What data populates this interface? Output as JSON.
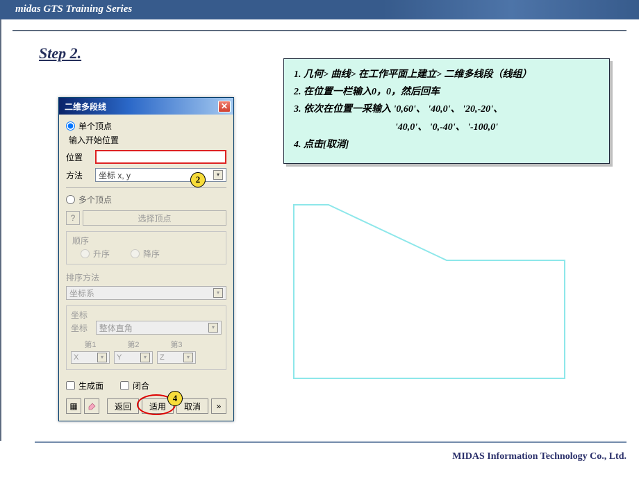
{
  "header": {
    "title": "midas GTS Training Series"
  },
  "step": {
    "label": "Step 2."
  },
  "instructions": {
    "line1": "1. 几何> 曲线> 在工作平面上建立> 二维多线段（线组）",
    "line2": "2. 在位置一栏输入0，0，然后回车",
    "line3": "3. 依次在位置一采输入 '0,60'、 '40,0'、 '20,-20'、",
    "line3b": "'40,0'、 '0,-40'、 '-100,0'",
    "line4": "4. 点击[取消]"
  },
  "dialog": {
    "title": "二维多段线",
    "radio_single": "单个顶点",
    "subtitle": "输入开始位置",
    "loc_label": "位置",
    "method_label": "方法",
    "method_value": "坐标 x, y",
    "radio_multi": "多个顶点",
    "select_vertex": "选择顶点",
    "order_title": "顺序",
    "asc": "升序",
    "desc": "降序",
    "sort_label": "排序方法",
    "sort_value": "坐标系",
    "coord_title": "坐标",
    "coord_label": "坐标",
    "coord_value": "整体直角",
    "col1": "第1",
    "col2": "第2",
    "col3": "第3",
    "c1": "X",
    "c2": "Y",
    "c3": "Z",
    "chk_face": "生成面",
    "chk_close": "闭合",
    "back": "返回",
    "apply": "适用",
    "cancel": "取消",
    "arrow": "»"
  },
  "markers": {
    "m2": "2",
    "m4": "4"
  },
  "footer": {
    "text": "MIDAS Information Technology Co., Ltd."
  }
}
